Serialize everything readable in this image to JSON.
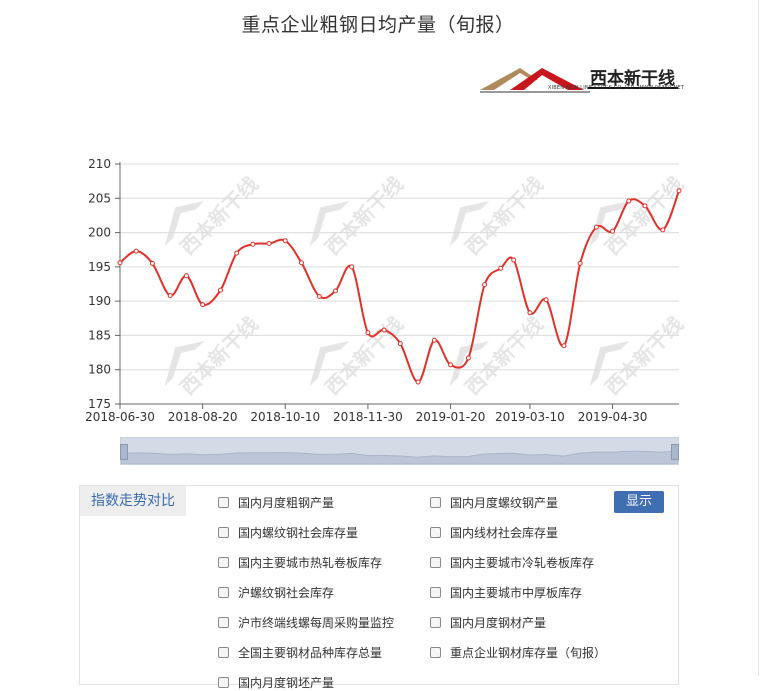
{
  "title": "重点企业粗钢日均产量（旬报）",
  "logo": {
    "text": "西本新干线",
    "subtext": "XIBEN NEW LINE STOCK CO.,LTD.   WWW.96369.NET",
    "watermark": "西本新干线"
  },
  "colors": {
    "line": "#e0322b",
    "grid": "#dcdcdc",
    "zoom_fill": "#d4dae6",
    "button": "#3f6fb2"
  },
  "chart_data": {
    "type": "line",
    "title": "重点企业粗钢日均产量（旬报）",
    "xlabel": "",
    "ylabel": "",
    "ylim": [
      175,
      210
    ],
    "yticks": [
      175,
      180,
      185,
      190,
      195,
      200,
      205,
      210
    ],
    "xticks": [
      "2018-06-30",
      "2018-08-20",
      "2018-10-10",
      "2018-11-30",
      "2019-01-20",
      "2019-03-10",
      "2019-04-30"
    ],
    "grid": true,
    "series": [
      {
        "name": "",
        "x": [
          "2018-06-30",
          "2018-07-10",
          "2018-07-20",
          "2018-07-31",
          "2018-08-10",
          "2018-08-20",
          "2018-08-31",
          "2018-09-10",
          "2018-09-20",
          "2018-09-30",
          "2018-10-10",
          "2018-10-20",
          "2018-10-31",
          "2018-11-10",
          "2018-11-20",
          "2018-11-30",
          "2018-12-10",
          "2018-12-20",
          "2018-12-31",
          "2019-01-10",
          "2019-01-20",
          "2019-01-31",
          "2019-02-10",
          "2019-02-20",
          "2019-02-28",
          "2019-03-10",
          "2019-03-20",
          "2019-03-31",
          "2019-04-10",
          "2019-04-20",
          "2019-04-30",
          "2019-05-10",
          "2019-05-20",
          "2019-05-31",
          "2019-06-10"
        ],
        "values": [
          195.6,
          197.3,
          195.5,
          190.8,
          193.7,
          189.5,
          191.6,
          197.0,
          198.3,
          198.4,
          198.8,
          195.6,
          190.7,
          191.5,
          195.0,
          185.4,
          185.8,
          183.8,
          178.2,
          184.3,
          180.7,
          181.7,
          192.4,
          194.8,
          196.0,
          188.3,
          190.2,
          183.5,
          195.5,
          200.8,
          200.2,
          204.6,
          203.9,
          200.4,
          206.1
        ]
      }
    ],
    "data_zoom": {
      "start": 0,
      "end": 100
    }
  },
  "panel": {
    "tab_label": "指数走势对比",
    "button_label": "显示",
    "options": [
      "国内月度粗钢产量",
      "国内月度螺纹钢产量",
      "国内螺纹钢社会库存量",
      "国内线材社会库存量",
      "国内主要城市热轧卷板库存",
      "国内主要城市冷轧卷板库存",
      "沪螺纹钢社会库存",
      "国内主要城市中厚板库存",
      "沪市终端线螺每周采购量监控",
      "国内月度钢材产量",
      "全国主要钢材品种库存总量",
      "重点企业钢材库存量（旬报）",
      "国内月度钢坯产量"
    ]
  }
}
